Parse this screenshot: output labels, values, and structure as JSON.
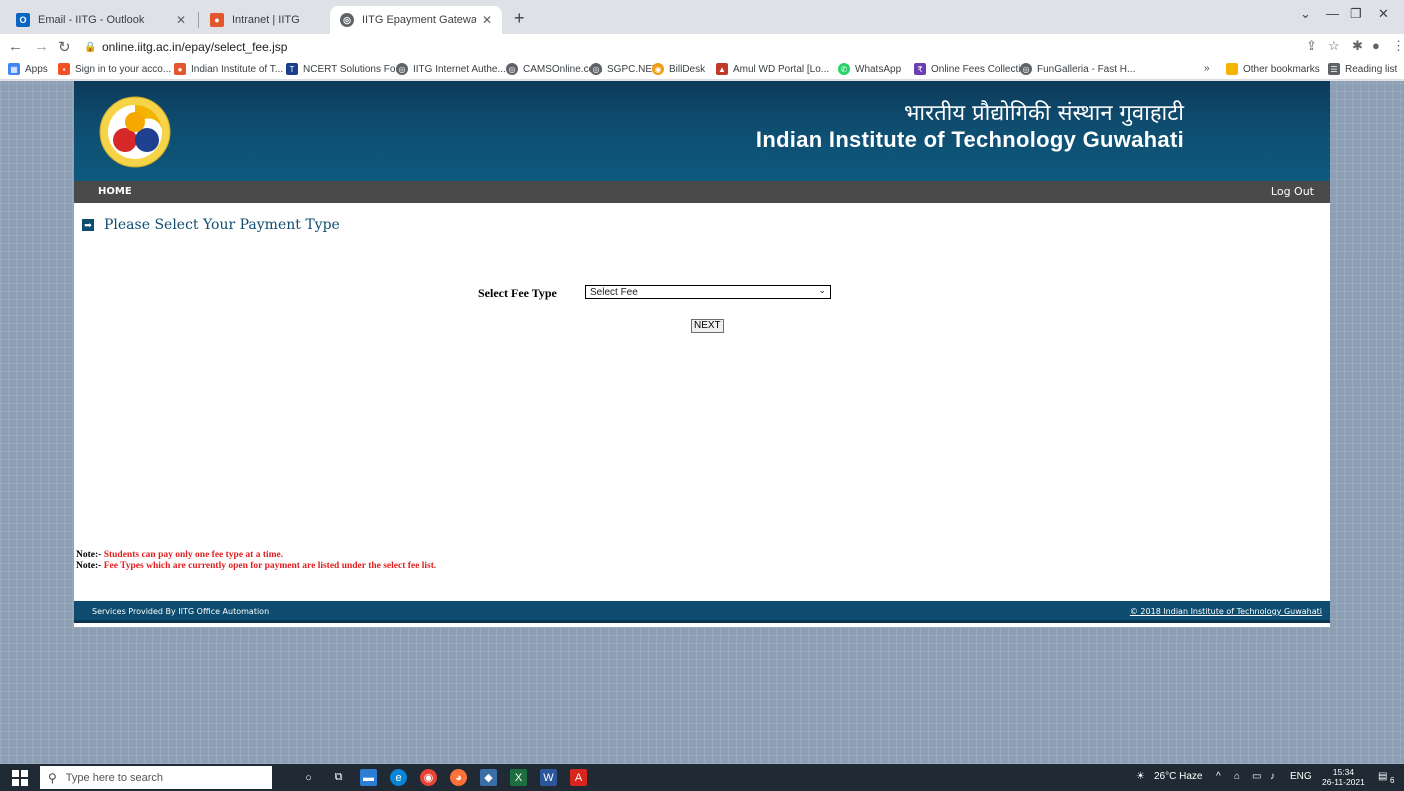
{
  "browser": {
    "tabs": [
      {
        "title": "Email - IITG - Outlook",
        "icon": "outlook-icon"
      },
      {
        "title": "Intranet | IITG",
        "icon": "iitg-icon"
      },
      {
        "title": "IITG Epayment Gateway",
        "icon": "globe-icon"
      }
    ],
    "url": "online.iitg.ac.in/epay/select_fee.jsp",
    "bookmarks": [
      "Apps",
      "Sign in to your acco...",
      "Indian Institute of T...",
      "NCERT Solutions Fo...",
      "IITG Internet Authe...",
      "CAMSOnline.com",
      "SGPC.NET",
      "BillDesk",
      "Amul WD Portal [Lo...",
      "WhatsApp",
      "Online Fees Collecti...",
      "FunGalleria - Fast H..."
    ],
    "more_bookmarks": "»",
    "other_bookmarks": "Other bookmarks",
    "reading_list": "Reading list"
  },
  "header": {
    "title_hindi": "भारतीय प्रौद्योगिकी संस्थान गुवाहाटी",
    "title_english": "Indian Institute of Technology  Guwahati"
  },
  "menu": {
    "home": "HOME",
    "logout": "Log Out"
  },
  "main": {
    "heading": "Please Select Your Payment Type",
    "fee_label": "Select Fee Type",
    "fee_selected": "Select Fee",
    "next_button": "NEXT"
  },
  "notes": [
    {
      "key": "Note:-",
      "text": " Students can pay only one fee type at a time."
    },
    {
      "key": "Note:-",
      "text": " Fee Types which are currently open for payment are listed under the select fee list."
    }
  ],
  "footer": {
    "left": "Services Provided By IITG Office Automation",
    "right": "© 2018 Indian Institute of Technology Guwahati"
  },
  "taskbar": {
    "search_placeholder": "Type here to search",
    "weather": "26°C  Haze",
    "lang": "ENG",
    "time": "15:34",
    "date": "26-11-2021",
    "notifications": "6"
  }
}
